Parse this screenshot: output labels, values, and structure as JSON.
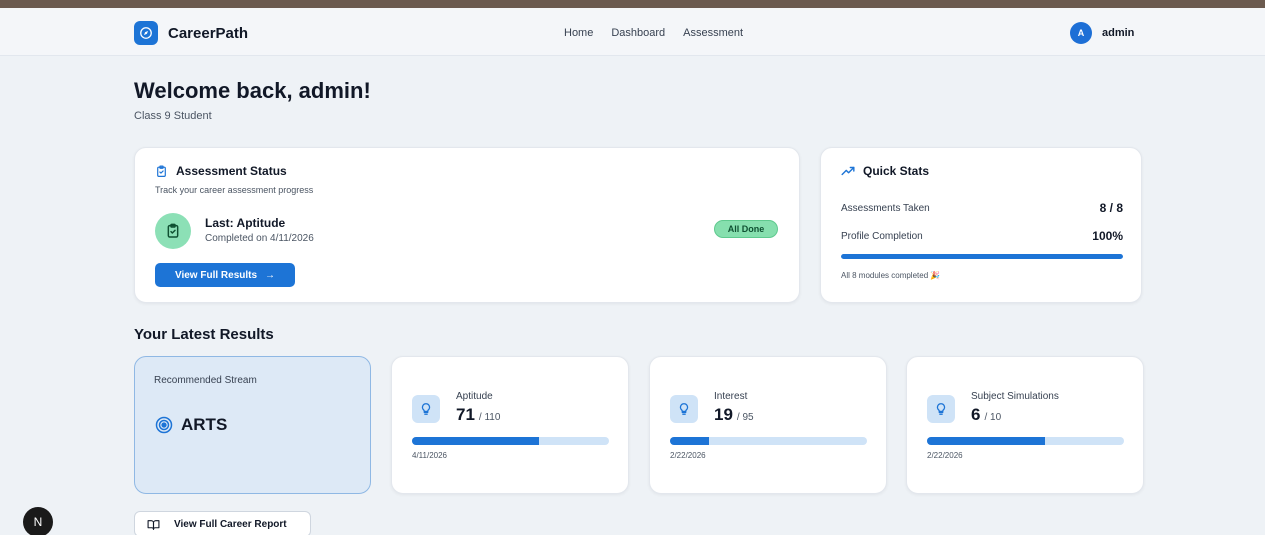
{
  "header": {
    "brand": "CareerPath",
    "nav": [
      "Home",
      "Dashboard",
      "Assessment"
    ],
    "avatar_initial": "A",
    "user_name": "admin"
  },
  "welcome": {
    "title": "Welcome back, admin!",
    "subtitle": "Class 9 Student"
  },
  "assessment_status": {
    "title": "Assessment Status",
    "description": "Track your career assessment progress",
    "last_label": "Last: Aptitude",
    "last_date": "Completed on 4/11/2026",
    "badge": "All Done",
    "button_label": "View Full Results",
    "button_arrow": "→"
  },
  "quick_stats": {
    "title": "Quick Stats",
    "rows": [
      {
        "label": "Assessments Taken",
        "value": "8 / 8"
      },
      {
        "label": "Profile Completion",
        "value": "100%"
      }
    ],
    "profile_completion_fraction": 1.0,
    "footer": "All 8 modules completed 🎉"
  },
  "latest_results": {
    "title": "Your Latest Results",
    "recommended": {
      "label": "Recommended Stream",
      "value": "ARTS"
    },
    "cards": [
      {
        "name": "Aptitude",
        "score": "71",
        "total": "/ 110",
        "fraction": 0.645,
        "date": "4/11/2026"
      },
      {
        "name": "Interest",
        "score": "19",
        "total": "/ 95",
        "fraction": 0.2,
        "date": "2/22/2026"
      },
      {
        "name": "Subject Simulations",
        "score": "6",
        "total": "/ 10",
        "fraction": 0.6,
        "date": "2/22/2026"
      }
    ]
  },
  "report_button": "View Full Career Report",
  "dev_badge": "N",
  "colors": {
    "primary": "#1d74d6",
    "success_bg": "#86dfae",
    "page_bg": "#eef2f6",
    "track": "#cfe3f7"
  }
}
